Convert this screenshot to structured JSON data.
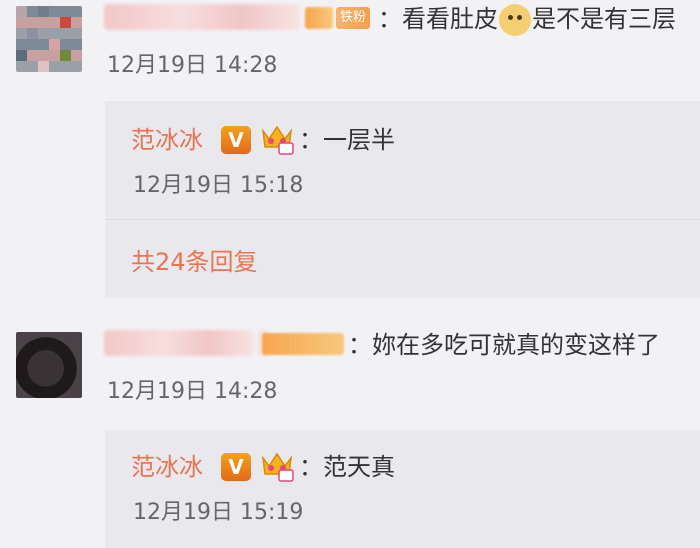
{
  "comments": [
    {
      "fan_tag": "铁粉",
      "text_prefix": "：看看肚皮",
      "text_suffix": "是不是有三层",
      "time": "12月19日 14:28",
      "reply": {
        "author": "范冰冰",
        "v_badge": "V",
        "text": "：一层半",
        "time": "12月19日 15:18"
      },
      "more_replies": "共24条回复"
    },
    {
      "text": "：妳在多吃可就真的变这样了",
      "time": "12月19日 14:28",
      "reply": {
        "author": "范冰冰",
        "v_badge": "V",
        "text": "：范天真",
        "time": "12月19日 15:19"
      }
    }
  ],
  "colors": {
    "accent": "#eb7350",
    "background": "#f2f2f5",
    "reply_background": "#e9e9ed"
  },
  "icons": [
    "doge-emoji-icon",
    "verified-v-icon",
    "crown-member-icon"
  ]
}
